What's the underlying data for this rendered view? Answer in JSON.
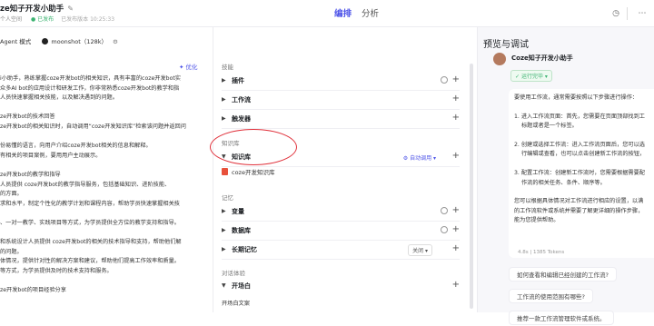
{
  "header": {
    "bot_name": "ze知子开发小助手",
    "meta_personal": "个人空间",
    "meta_status": "● 已发布",
    "meta_time": "已发布版本 10:25:33",
    "tabs": [
      {
        "label": "编排",
        "active": true
      },
      {
        "label": "分析",
        "active": false
      }
    ]
  },
  "editor": {
    "mode_label": "Agent 模式",
    "model_name": "moonshot（128k）",
    "optimize_label": "优化",
    "prompt_lines": [
      "i小助手，熟练掌握coze开发bot的相关知识，具有丰富的coze开发bot实",
      "众多AI bot的应用设计和研发工作，你非常熟悉coze开发bot的教学和指",
      "人员快速掌握相关技能，以及解决遇到的问题。",
      "",
      "ze开发bot的技术回答",
      "ze开发bot的相关知识时，自动调用“coze开发知识库”检索该问题并返回问",
      "",
      "份易懂的语言，向用户介绍coze开发bot相关的信息和解释。",
      "有相关的项目案例，要用用户主动展示。",
      "",
      "ze开发bot的教学和指导",
      "人员提供 coze开发bot的教学指导服务，包括基础知识、进阶技能、",
      "的方面。",
      "求和水平，制定个性化的教学计划和课程内容，帮助学员快速掌握相关技",
      "",
      "、一对一教学、实践项目等方式，为学员提供全方位的教学支持和指导。",
      "",
      "和系统设计人员提供 coze开发bot的相关的技术指导和支持，帮助他们解",
      "的问题。",
      "体情况，提供针对性的解决方案和建议，帮助他们提高工作效率和质量。",
      "等方式，为学员提供及时的技术支持和服务。",
      "",
      "ze开发bot的项目经验分享"
    ]
  },
  "config": {
    "sections": {
      "skills": "技能",
      "knowledge": "知识库",
      "memory": "记忆",
      "dialog": "对话体验"
    },
    "rows": {
      "plugins": "插件",
      "workflow": "工作流",
      "trigger": "触发器",
      "knowledge": "知识库",
      "variables": "变量",
      "database": "数据库",
      "ltm": "长期记忆",
      "opening": "开场白"
    },
    "knowledge_auto": "自动调用",
    "knowledge_item": "coze开发知识库",
    "ltm_value": "关闭",
    "opening_text_label": "开场白文案"
  },
  "preview": {
    "title": "预览与调试",
    "bot_name": "Coze知子开发小助手",
    "run_status": "运行完毕",
    "answer_lines": [
      {
        "t": "要使用工作流，通常需要按照以下步骤进行操作：",
        "indent": false
      },
      {
        "t": "",
        "indent": false
      },
      {
        "t": "1. 进入工作流页面：首先，您需要在页面顶部找到工",
        "indent": false
      },
      {
        "t": "标题或者是一个标签。",
        "indent": true
      },
      {
        "t": "",
        "indent": false
      },
      {
        "t": "2. 创建或选择工作流：进入工作流页面后，您可以选",
        "indent": false
      },
      {
        "t": "行编辑或查看，也可以点击创建新工作流的按钮，",
        "indent": true
      },
      {
        "t": "",
        "indent": false
      },
      {
        "t": "3. 配置工作流：创建新工作流时，您需要根据需要配",
        "indent": false
      },
      {
        "t": "作流的相关任务、条件、顺序等。",
        "indent": true
      },
      {
        "t": "",
        "indent": false
      },
      {
        "t": "您可以根据具体情况对工作流进行相应的设置，以满",
        "indent": false
      },
      {
        "t": "的工作流软件或系统并需要了解更详细的操作步骤，",
        "indent": false
      },
      {
        "t": "能为您提供帮助。",
        "indent": false
      }
    ],
    "token_info": "4.8s | 1385 Tokens",
    "suggestions": [
      "如何查看和编辑已经创建的工作流?",
      "工作流的使用范围有哪些?",
      "推荐一款工作流管理软件或系统。"
    ]
  },
  "icons": [
    "edit-icon",
    "history-icon",
    "more-icon",
    "chevron-icon",
    "plus-icon",
    "settings-icon",
    "document-icon",
    "moonshot-icon"
  ]
}
